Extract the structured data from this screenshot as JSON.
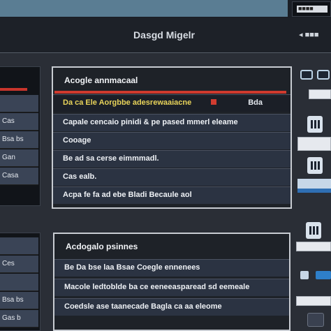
{
  "header": {
    "title": "Dasgd Migelr",
    "menu_arrow": "◂ ■■■",
    "top_right_label": "■■■■"
  },
  "sidebar_top": {
    "items": [
      "",
      "Cas",
      "Bsa bs",
      "Gan",
      "Casa"
    ]
  },
  "sidebar_bottom": {
    "items": [
      "",
      "Ces",
      "",
      "Bsa bs",
      "Gas b"
    ]
  },
  "panel_top": {
    "title": "Acogle annmacaal",
    "rows": [
      {
        "text": "Da ca Ele Aorgbbe adesrewaaiacne",
        "badge": "Bda"
      },
      {
        "text": "Capale cencaio pinidi & pe pased mmerl eleame"
      },
      {
        "text": "Cooage"
      },
      {
        "text": "Be ad sa cerse eimmmadl."
      },
      {
        "text": "Cas ealb."
      },
      {
        "text": "Acpa fe fa ad ebe Bladi Becaule aol"
      }
    ]
  },
  "panel_bottom": {
    "title": "Acdogalo psinnes",
    "rows": [
      {
        "text": "Be Da bse laa Bsae Coegle ennenees"
      },
      {
        "text": "Macole ledtoblde ba ce eeneeasparead sd eemeale"
      },
      {
        "text": "Coedsle ase taanecade Bagla ca aa eleome"
      }
    ]
  },
  "colors": {
    "accent_red": "#c8352c",
    "accent_blue": "#5a7d93",
    "row_fill": "#2b3342"
  },
  "icons": [
    "window-icon",
    "columns-icon",
    "toggle-icon",
    "gear-icon"
  ]
}
